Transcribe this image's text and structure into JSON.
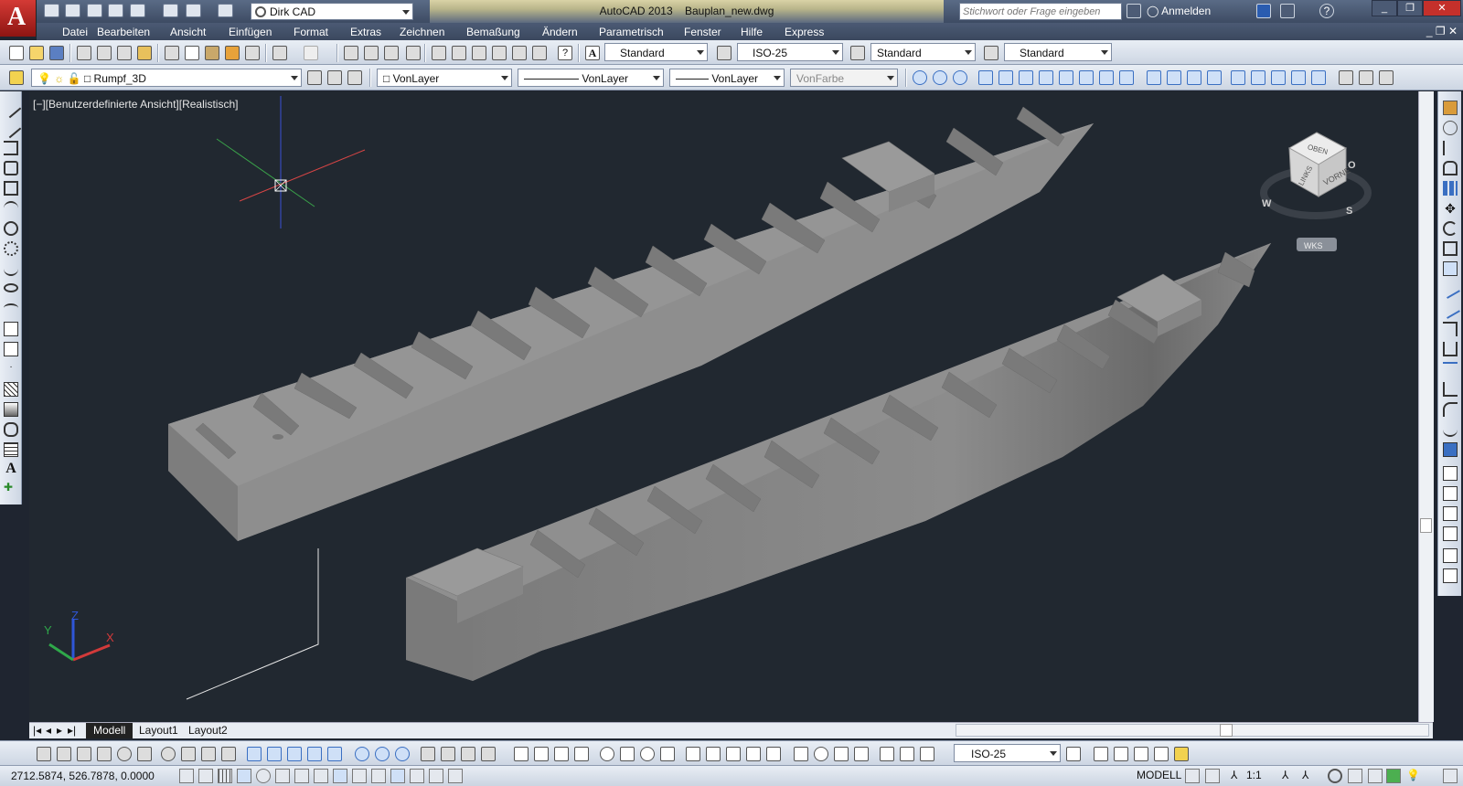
{
  "app": {
    "title": "AutoCAD 2013",
    "file": "Bauplan_new.dwg",
    "workspace": "Dirk CAD",
    "search_placeholder": "Stichwort oder Frage eingeben",
    "signin": "Anmelden"
  },
  "menu": [
    "Datei",
    "Bearbeiten",
    "Ansicht",
    "Einfügen",
    "Format",
    "Extras",
    "Zeichnen",
    "Bemaßung",
    "Ändern",
    "Parametrisch",
    "Fenster",
    "Hilfe",
    "Express"
  ],
  "styles": {
    "text_style": "Standard",
    "dim_style": "ISO-25",
    "table_style": "Standard",
    "multileader_style": "Standard"
  },
  "layers": {
    "current": "Rumpf_3D",
    "color": "VonLayer",
    "linetype": "VonLayer",
    "lineweight": "VonLayer",
    "plotstyle": "VonFarbe"
  },
  "viewport": {
    "label": "[−][Benutzerdefinierte Ansicht][Realistisch]",
    "viewcube": {
      "top": "OBEN",
      "left": "LINKS",
      "front": "VORNE",
      "compass_w": "W",
      "compass_s": "S",
      "compass_o": "O"
    },
    "ucs_label": "WKS",
    "axes": {
      "x": "X",
      "y": "Y",
      "z": "Z"
    }
  },
  "tabs": [
    "Modell",
    "Layout1",
    "Layout2"
  ],
  "bottom": {
    "dim_style": "ISO-25"
  },
  "status": {
    "coords": "2712.5874, 526.7878, 0.0000",
    "model": "MODELL",
    "scale": "1:1"
  },
  "colors": {
    "viewport_bg": "#212830",
    "hull": "#8d8d8d",
    "titlebar": "#3d4b63",
    "app_button": "#c4302b"
  }
}
